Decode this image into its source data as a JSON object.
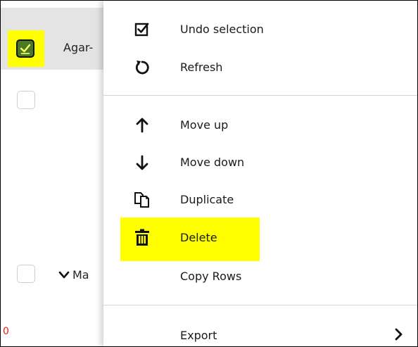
{
  "grid": {
    "rows": [
      {
        "label": "Agar-",
        "checked": true
      },
      {
        "label": "",
        "checked": false
      },
      {
        "label": "Ma",
        "checked": false,
        "expandable": true
      }
    ],
    "row_count": "0"
  },
  "context_menu": {
    "items": [
      {
        "label": "Undo selection",
        "icon": "checkbox-icon"
      },
      {
        "label": "Refresh",
        "icon": "refresh-icon"
      },
      {
        "label": "Move up",
        "icon": "arrow-up-icon"
      },
      {
        "label": "Move down",
        "icon": "arrow-down-icon"
      },
      {
        "label": "Duplicate",
        "icon": "duplicate-icon"
      },
      {
        "label": "Delete",
        "icon": "trash-icon",
        "highlighted": true
      },
      {
        "label": "Copy Rows",
        "icon": ""
      },
      {
        "label": "Export",
        "icon": "",
        "submenu": true
      }
    ]
  },
  "colors": {
    "highlight": "#ffff00",
    "check_fill": "#4a7a26",
    "row_count": "#e0241b"
  }
}
